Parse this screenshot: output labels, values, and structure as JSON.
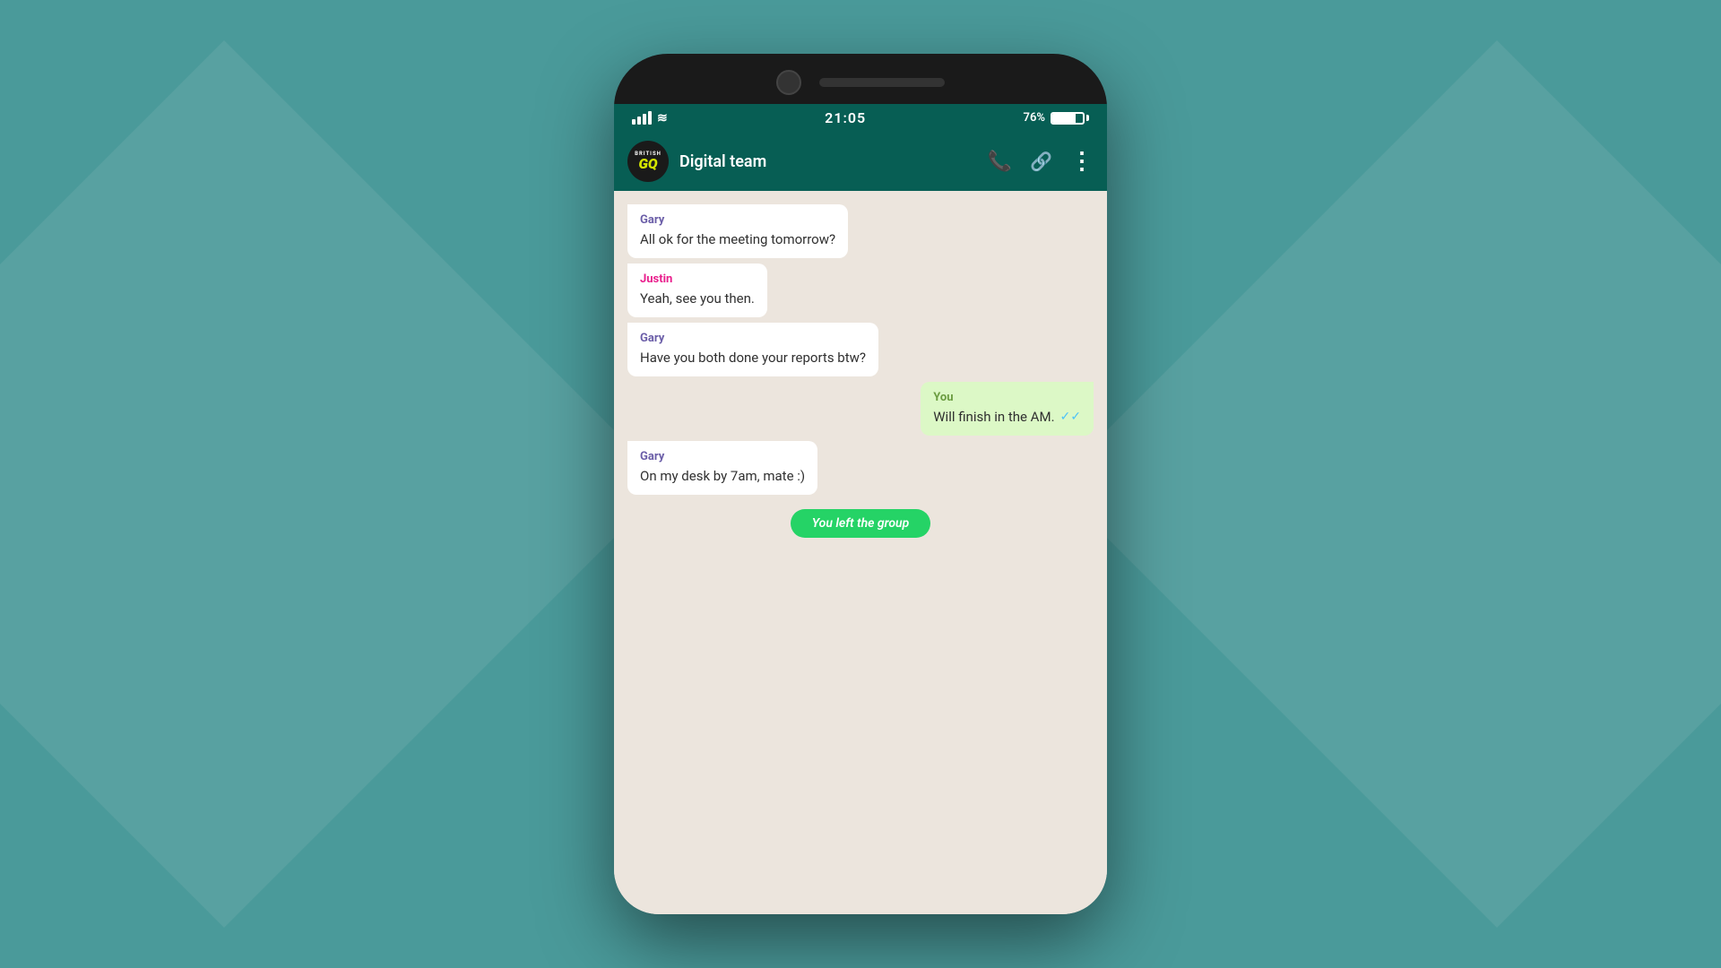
{
  "background": {
    "color": "#4a9a9a"
  },
  "statusBar": {
    "time": "21:05",
    "batteryPercent": "76%",
    "signalBars": [
      6,
      9,
      12,
      15
    ]
  },
  "chatHeader": {
    "groupName": "Digital team",
    "avatarBritish": "BRITISH",
    "avatarGQ": "GQ"
  },
  "messages": [
    {
      "id": 1,
      "sender": "Gary",
      "senderClass": "sender-gary",
      "type": "received",
      "text": "All ok for the meeting tomorrow?"
    },
    {
      "id": 2,
      "sender": "Justin",
      "senderClass": "sender-justin",
      "type": "received",
      "text": "Yeah, see you then."
    },
    {
      "id": 3,
      "sender": "Gary",
      "senderClass": "sender-gary",
      "type": "received",
      "text": "Have you both done your reports btw?"
    },
    {
      "id": 4,
      "sender": "You",
      "senderClass": "sender-you",
      "type": "sent",
      "text": "Will finish in the AM.",
      "ticks": "✓✓"
    },
    {
      "id": 5,
      "sender": "Gary",
      "senderClass": "sender-gary",
      "type": "received",
      "text": "On my desk by 7am, mate :)"
    }
  ],
  "systemMessage": {
    "text": "You left the group"
  },
  "icons": {
    "phone": "📞",
    "link": "🔗",
    "more": "⋮"
  }
}
